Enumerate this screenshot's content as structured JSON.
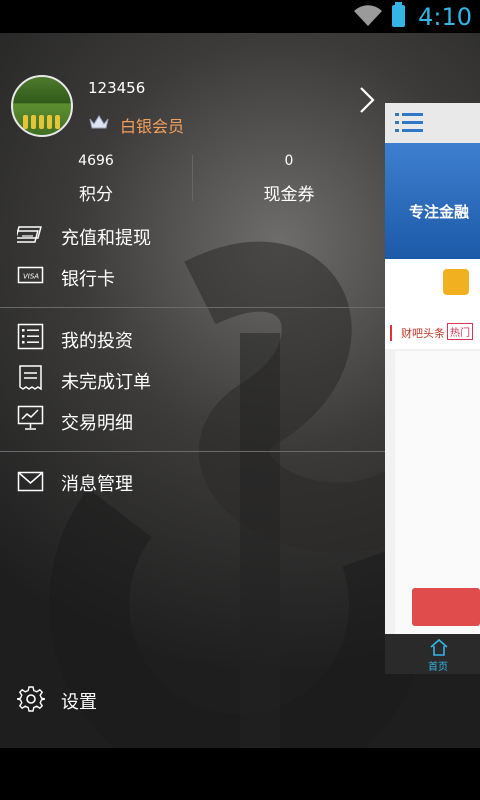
{
  "status_bar": {
    "time": "4:10"
  },
  "profile": {
    "username": "123456",
    "member_level": "白银会员"
  },
  "stats": [
    {
      "value": "4696",
      "label": "积分"
    },
    {
      "value": "0",
      "label": "现金券"
    }
  ],
  "menu": {
    "recharge": {
      "label": "充值和提现",
      "icon": "money-icon"
    },
    "bank_card": {
      "label": "银行卡",
      "icon": "visa-card-icon"
    },
    "my_invest": {
      "label": "我的投资",
      "icon": "list-icon"
    },
    "pending_orders": {
      "label": "未完成订单",
      "icon": "receipt-icon"
    },
    "transactions": {
      "label": "交易明细",
      "icon": "chart-board-icon"
    },
    "messages": {
      "label": "消息管理",
      "icon": "envelope-icon"
    },
    "settings": {
      "label": "设置",
      "icon": "gear-icon"
    }
  },
  "background_panel": {
    "banner_text": "专注金融",
    "news_label": "财吧头条",
    "news_tag": "热门",
    "nav_home": "首页"
  },
  "colors": {
    "accent": "#33b5e5",
    "member": "#f5a05a"
  }
}
